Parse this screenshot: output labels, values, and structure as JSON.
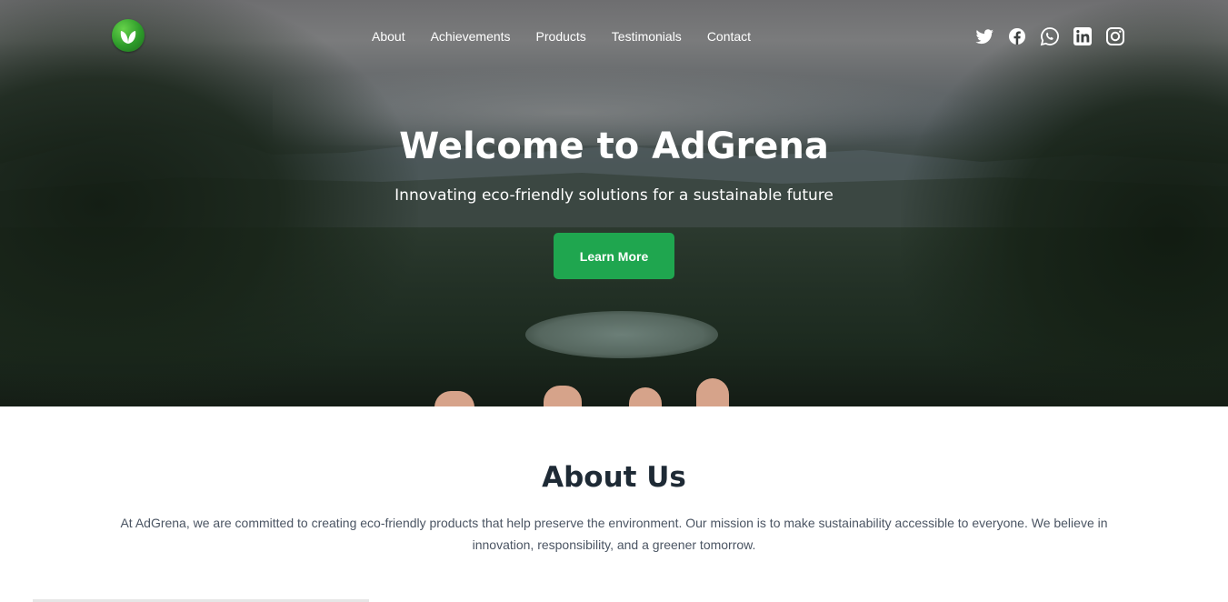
{
  "brand": {
    "logo_icon": "leaf-logo-icon"
  },
  "nav": {
    "items": [
      {
        "label": "About"
      },
      {
        "label": "Achievements"
      },
      {
        "label": "Products"
      },
      {
        "label": "Testimonials"
      },
      {
        "label": "Contact"
      }
    ]
  },
  "social": {
    "icons": [
      "twitter-icon",
      "facebook-icon",
      "whatsapp-icon",
      "linkedin-icon",
      "instagram-icon"
    ]
  },
  "hero": {
    "title": "Welcome to AdGrena",
    "subtitle": "Innovating eco-friendly solutions for a sustainable future",
    "cta_label": "Learn More"
  },
  "about": {
    "title": "About Us",
    "text": "At AdGrena, we are committed to creating eco-friendly products that help preserve the environment. Our mission is to make sustainability accessible to everyone. We believe in innovation, responsibility, and a greener tomorrow."
  },
  "colors": {
    "accent": "#1fa64f",
    "heading": "#1e2a35",
    "body_text": "#4b5563"
  }
}
